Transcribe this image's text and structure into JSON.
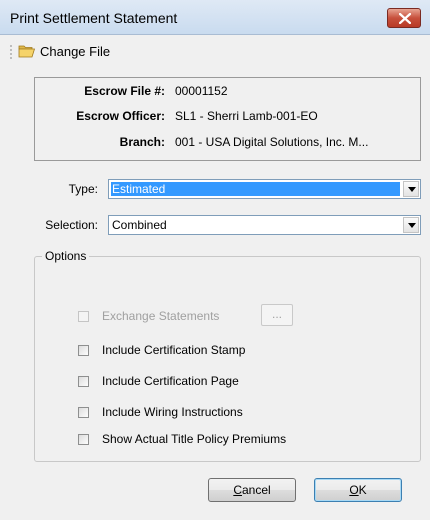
{
  "window": {
    "title": "Print Settlement Statement"
  },
  "toolbar": {
    "change_file_label": "Change File"
  },
  "info": {
    "escrow_file_label": "Escrow File #:",
    "escrow_file_value": "00001152",
    "escrow_officer_label": "Escrow Officer:",
    "escrow_officer_value": "SL1 - Sherri Lamb-001-EO",
    "branch_label": "Branch:",
    "branch_value": "001 - USA Digital Solutions, Inc. M..."
  },
  "type": {
    "label": "Type:",
    "value": "Estimated"
  },
  "selection": {
    "label": "Selection:",
    "value": "Combined"
  },
  "options": {
    "title": "Options",
    "exchange_statements": {
      "label": "Exchange Statements",
      "checked": false,
      "enabled": false
    },
    "ellipsis_label": "...",
    "certification_stamp": {
      "label": "Include Certification Stamp",
      "checked": false
    },
    "certification_page": {
      "label": "Include Certification Page",
      "checked": false
    },
    "wiring_instructions": {
      "label": "Include Wiring Instructions",
      "checked": false
    },
    "actual_title_policy": {
      "label": "Show Actual Title Policy Premiums",
      "checked": false
    }
  },
  "buttons": {
    "cancel_mnemonic": "C",
    "cancel_rest": "ancel",
    "ok_mnemonic": "O",
    "ok_rest": "K"
  },
  "colors": {
    "selection_highlight": "#3399ff",
    "close_button": "#c7503c"
  }
}
